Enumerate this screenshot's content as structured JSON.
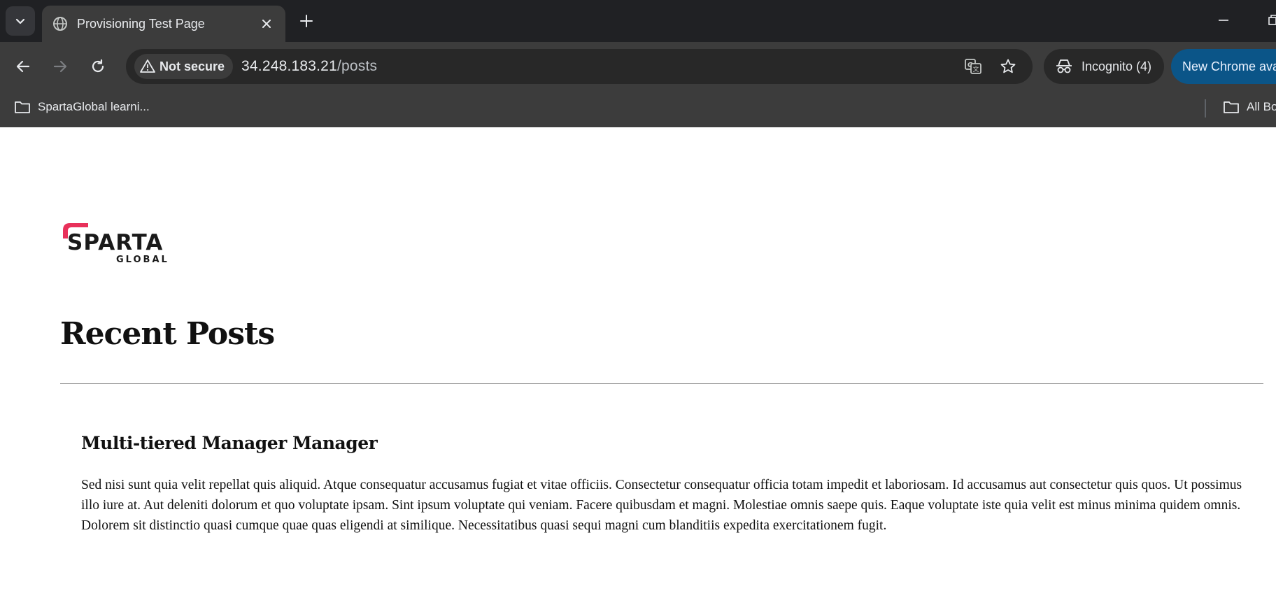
{
  "browser": {
    "tab": {
      "title": "Provisioning Test Page",
      "favicon": "globe-icon",
      "close_icon": "close-icon"
    },
    "new_tab_icon": "plus-icon",
    "omnibox": {
      "security_label": "Not secure",
      "url_host": "34.248.183.21",
      "url_path": "/posts"
    },
    "incognito_label": "Incognito (4)",
    "update_label": "New Chrome available",
    "bookmarks": {
      "items": [
        {
          "label": "SpartaGlobal learni..."
        }
      ],
      "all_bookmarks_label": "All Bookmarks"
    }
  },
  "page": {
    "logo": {
      "text": "SPARTA",
      "subtext": "GLOBAL",
      "accent_color": "#e8305a"
    },
    "title": "Recent Posts",
    "posts": [
      {
        "title": "Multi-tiered Manager Manager",
        "body": "Sed nisi sunt quia velit repellat quis aliquid. Atque consequatur accusamus fugiat et vitae officiis. Consectetur consequatur officia totam impedit et laboriosam. Id accusamus aut consectetur quis quos. Ut possimus illo iure at. Aut deleniti dolorum et quo voluptate ipsam. Sint ipsum voluptate qui veniam. Facere quibusdam et magni. Molestiae omnis saepe quis. Eaque voluptate iste quia velit est minus minima quidem omnis. Dolorem sit distinctio quasi cumque quae quas eligendi at similique. Necessitatibus quasi sequi magni cum blanditiis expedita exercitationem fugit."
      }
    ]
  }
}
